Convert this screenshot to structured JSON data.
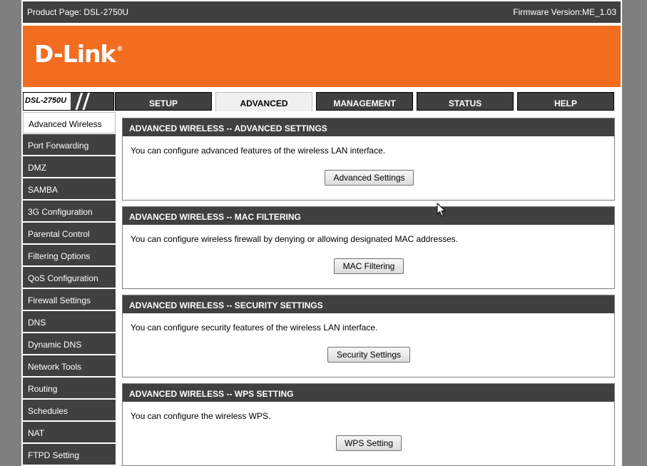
{
  "topbar": {
    "product": "Product Page: DSL-2750U",
    "firmware": "Firmware Version:ME_1.03"
  },
  "brand": {
    "logo": "D-Link",
    "reg_mark": "®"
  },
  "model": "DSL-2750U",
  "tabs": [
    "SETUP",
    "ADVANCED",
    "MANAGEMENT",
    "STATUS",
    "HELP"
  ],
  "active_tab": "ADVANCED",
  "sidebar": [
    "Advanced Wireless",
    "Port Forwarding",
    "DMZ",
    "SAMBA",
    "3G Configuration",
    "Parental Control",
    "Filtering Options",
    "QoS Configuration",
    "Firewall Settings",
    "DNS",
    "Dynamic DNS",
    "Network Tools",
    "Routing",
    "Schedules",
    "NAT",
    "FTPD Setting"
  ],
  "active_sidebar": "Advanced Wireless",
  "sections": [
    {
      "title": "ADVANCED WIRELESS -- ADVANCED SETTINGS",
      "text": "You can configure advanced features of the wireless LAN interface.",
      "button": "Advanced Settings"
    },
    {
      "title": "ADVANCED WIRELESS -- MAC FILTERING",
      "text": "You can configure wireless firewall by denying or allowing designated MAC addresses.",
      "button": "MAC Filtering"
    },
    {
      "title": "ADVANCED WIRELESS -- SECURITY SETTINGS",
      "text": "You can configure security features of the wireless LAN interface.",
      "button": "Security Settings"
    },
    {
      "title": "ADVANCED WIRELESS -- WPS SETTING",
      "text": "You can configure the wireless WPS.",
      "button": "WPS Setting"
    }
  ],
  "colors": {
    "brand_orange": "#f36d21",
    "dark_gray": "#404040",
    "outer_gray": "#7f7f7f"
  },
  "icons": {
    "pointer": "mouse-pointer-icon"
  }
}
